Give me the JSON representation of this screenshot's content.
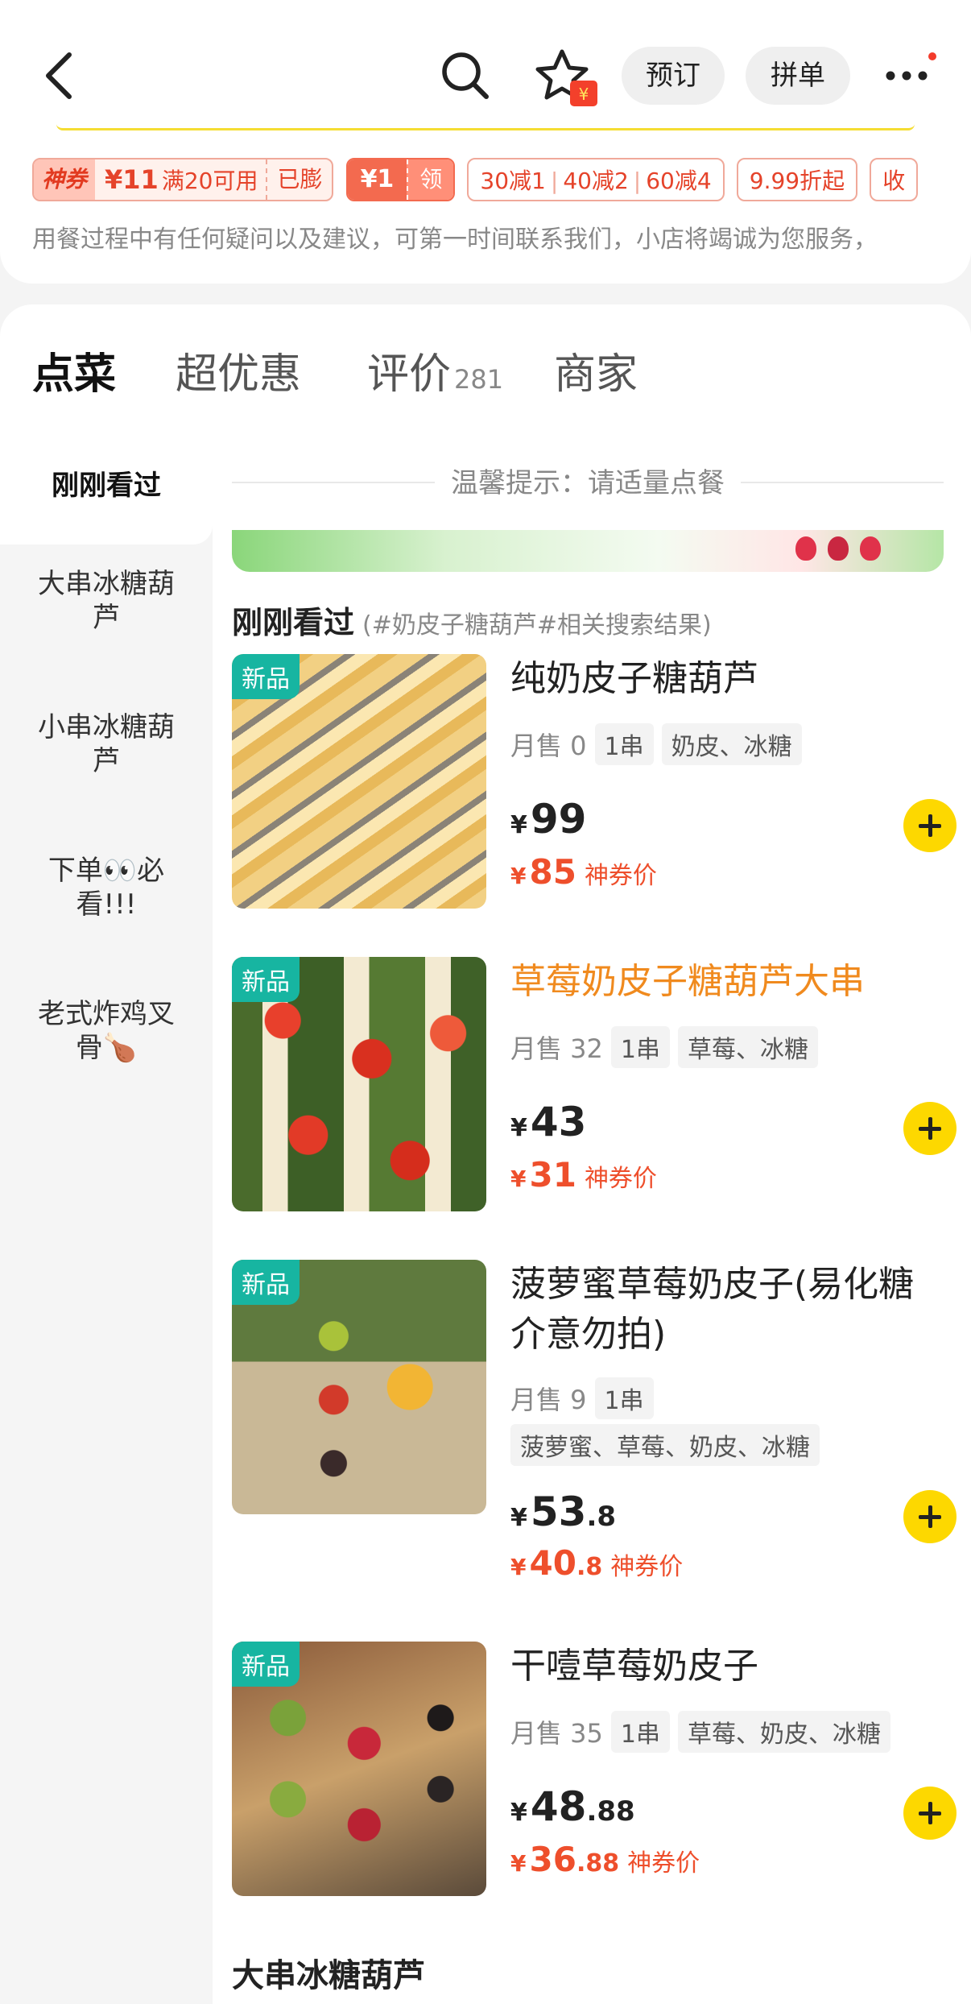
{
  "header": {
    "reserve_label": "预订",
    "group_label": "拼单",
    "fav_badge": "¥"
  },
  "coupons": {
    "main": {
      "tag": "神券",
      "amount": "¥11",
      "condition": "满20可用",
      "status": "已膨"
    },
    "yuan": {
      "amount": "¥1",
      "action": "领"
    },
    "reduce": {
      "items": [
        "30减1",
        "40减2",
        "60减4"
      ]
    },
    "discount": {
      "label": "9.99折起"
    },
    "partial": {
      "label": "收"
    }
  },
  "notice": "用餐过程中有任何疑问以及建议，可第一时间联系我们，小店将竭诚为您服务，",
  "tabs": [
    {
      "label": "点菜"
    },
    {
      "label": "超优惠"
    },
    {
      "label": "评价",
      "count": "281"
    },
    {
      "label": "商家"
    }
  ],
  "sidebar": [
    {
      "label": "刚刚看过"
    },
    {
      "label": "大串冰糖葫芦"
    },
    {
      "label": "小串冰糖葫芦"
    },
    {
      "label": "下单👀必看!!!"
    },
    {
      "label": "老式炸鸡叉骨🍗"
    }
  ],
  "content": {
    "tip": "温馨提示：请适量点餐",
    "section_title": "刚刚看过",
    "section_sub": "(#奶皮子糖葫芦#相关搜索结果)",
    "next_section_title": "大串冰糖葫芦"
  },
  "items": [
    {
      "badge": "新品",
      "name": "纯奶皮子糖葫芦",
      "sales": "月售 0",
      "unit": "1串",
      "tags": [
        "奶皮、冰糖"
      ],
      "price_int": "99",
      "price_dec": "",
      "discount_int": "85",
      "discount_dec": "",
      "discount_label": "神券价"
    },
    {
      "badge": "新品",
      "name": "草莓奶皮子糖葫芦大串",
      "sales": "月售 32",
      "unit": "1串",
      "tags": [
        "草莓、冰糖"
      ],
      "price_int": "43",
      "price_dec": "",
      "discount_int": "31",
      "discount_dec": "",
      "discount_label": "神券价"
    },
    {
      "badge": "新品",
      "name": "菠萝蜜草莓奶皮子(易化糖介意勿拍)",
      "sales": "月售 9",
      "unit": "1串",
      "tags": [
        "菠萝蜜、草莓、奶皮、冰糖"
      ],
      "price_int": "53",
      "price_dec": ".8",
      "discount_int": "40",
      "discount_dec": ".8",
      "discount_label": "神券价"
    },
    {
      "badge": "新品",
      "name": "干噎草莓奶皮子",
      "sales": "月售 35",
      "unit": "1串",
      "tags": [
        "草莓、奶皮、冰糖"
      ],
      "price_int": "48",
      "price_dec": ".88",
      "discount_int": "36",
      "discount_dec": ".88",
      "discount_label": "神券价"
    }
  ],
  "currency": "¥",
  "colors": {
    "accent_yellow": "#fdd800",
    "discount_red": "#ee4f2c",
    "new_badge": "#17b5a1",
    "highlight_orange": "#f08a1e"
  }
}
